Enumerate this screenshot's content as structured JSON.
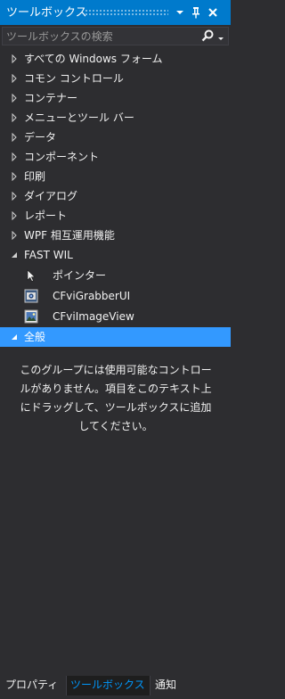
{
  "window": {
    "title": "ツールボックス"
  },
  "search": {
    "placeholder": "ツールボックスの検索"
  },
  "groups": [
    {
      "label": "すべての Windows フォーム"
    },
    {
      "label": "コモン コントロール"
    },
    {
      "label": "コンテナー"
    },
    {
      "label": "メニューとツール バー"
    },
    {
      "label": "データ"
    },
    {
      "label": "コンポーネント"
    },
    {
      "label": "印刷"
    },
    {
      "label": "ダイアログ"
    },
    {
      "label": "レポート"
    },
    {
      "label": "WPF 相互運用機能"
    }
  ],
  "fast_wil": {
    "label": "FAST WIL",
    "items": [
      {
        "label": "ポインター",
        "icon": "pointer-icon"
      },
      {
        "label": "CFviGrabberUI",
        "icon": "grabber-component-icon"
      },
      {
        "label": "CFviImageView",
        "icon": "image-view-component-icon"
      }
    ]
  },
  "general": {
    "label": "全般",
    "empty_lines": [
      "このグループには使用可能なコントロー",
      "ルがありません。項目をこのテキスト上",
      "にドラッグして、ツールボックスに追加",
      "してください。"
    ]
  },
  "tabs": [
    {
      "label": "プロパティ"
    },
    {
      "label": "ツールボックス"
    },
    {
      "label": "通知"
    }
  ],
  "colors": {
    "titlebar": "#007acc",
    "background": "#2d2d30",
    "selected_row": "#3399ff",
    "active_tab_text": "#0097fb"
  }
}
